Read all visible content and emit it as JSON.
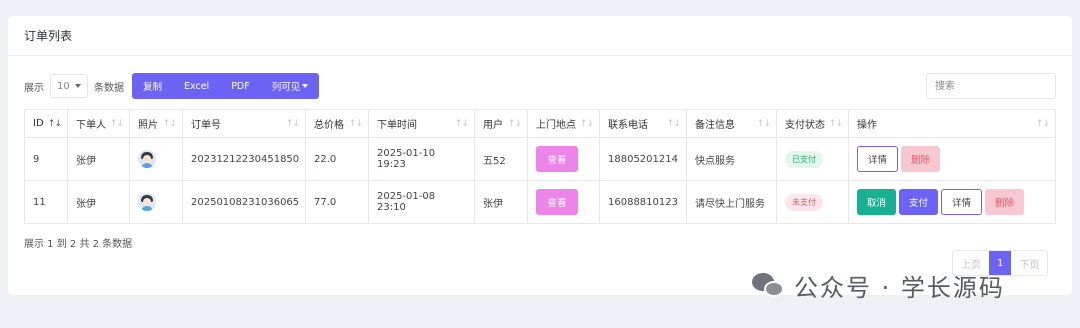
{
  "card": {
    "title": "订单列表"
  },
  "toolbar": {
    "show_prefix": "展示",
    "page_size": "10",
    "show_suffix": "条数据",
    "buttons": [
      "复制",
      "Excel",
      "PDF",
      "列可见"
    ],
    "search_placeholder": "搜索"
  },
  "table": {
    "headers": [
      "ID",
      "下单人",
      "照片",
      "订单号",
      "总价格",
      "下单时间",
      "用户",
      "上门地点",
      "联系电话",
      "备注信息",
      "支付状态",
      "操作"
    ],
    "rows": [
      {
        "id": "9",
        "customer": "张伊",
        "order_no": "20231212230451850",
        "total": "22.0",
        "time": "2025-01-10 19:23",
        "user": "五52",
        "location_btn": "查看",
        "phone": "18805201214",
        "remark": "快点服务",
        "status": "已支付",
        "actions": [
          "详情",
          "删除"
        ]
      },
      {
        "id": "11",
        "customer": "张伊",
        "order_no": "20250108231036065",
        "total": "77.0",
        "time": "2025-01-08 23:10",
        "user": "张伊",
        "location_btn": "查看",
        "phone": "16088810123",
        "remark": "请尽快上门服务",
        "status": "未支付",
        "actions": [
          "取消",
          "支付",
          "详情",
          "删除"
        ]
      }
    ]
  },
  "info": "展示 1 到 2 共 2 条数据",
  "pager": {
    "prev": "上页",
    "current": "1",
    "next": "下页"
  },
  "watermark": "公众号 · 学长源码",
  "colors": {
    "accent": "#6c63f5",
    "pink": "#ec84e9",
    "success": "#17b092",
    "danger": "#e2576d"
  }
}
